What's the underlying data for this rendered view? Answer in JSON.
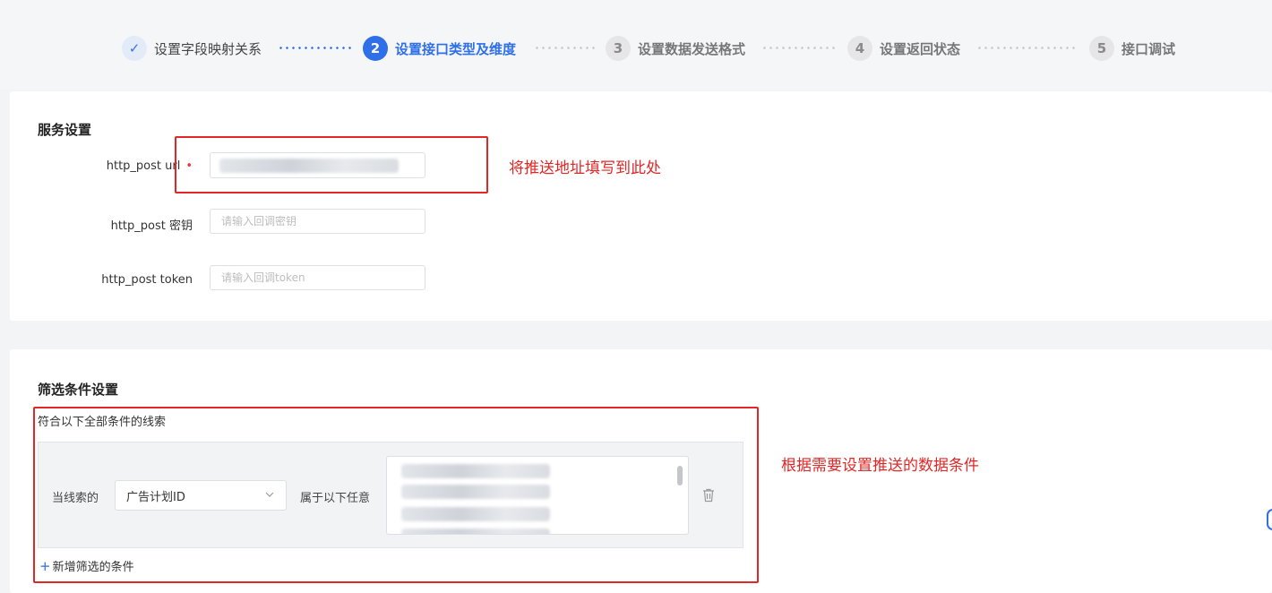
{
  "steps": [
    {
      "num": "✓",
      "label": "设置字段映射关系",
      "state": "done"
    },
    {
      "num": "2",
      "label": "设置接口类型及维度",
      "state": "active"
    },
    {
      "num": "3",
      "label": "设置数据发送格式",
      "state": "todo"
    },
    {
      "num": "4",
      "label": "设置返回状态",
      "state": "todo"
    },
    {
      "num": "5",
      "label": "接口调试",
      "state": "todo"
    }
  ],
  "service": {
    "title": "服务设置",
    "url_label": "http_post url",
    "url_required": "•",
    "secret_label": "http_post 密钥",
    "secret_placeholder": "请输入回调密钥",
    "token_label": "http_post token",
    "token_placeholder": "请输入回调token"
  },
  "filter": {
    "title": "筛选条件设置",
    "subtitle": "符合以下全部条件的线索",
    "when_label": "当线索的",
    "field_select": "广告计划ID",
    "belongs_label": "属于以下任意",
    "add_label": "新增筛选的条件"
  },
  "annotations": {
    "url_note": "将推送地址填写到此处",
    "filter_note": "根据需要设置推送的数据条件"
  },
  "colors": {
    "primary": "#2f6fe8",
    "annotation_red": "#e32626"
  }
}
